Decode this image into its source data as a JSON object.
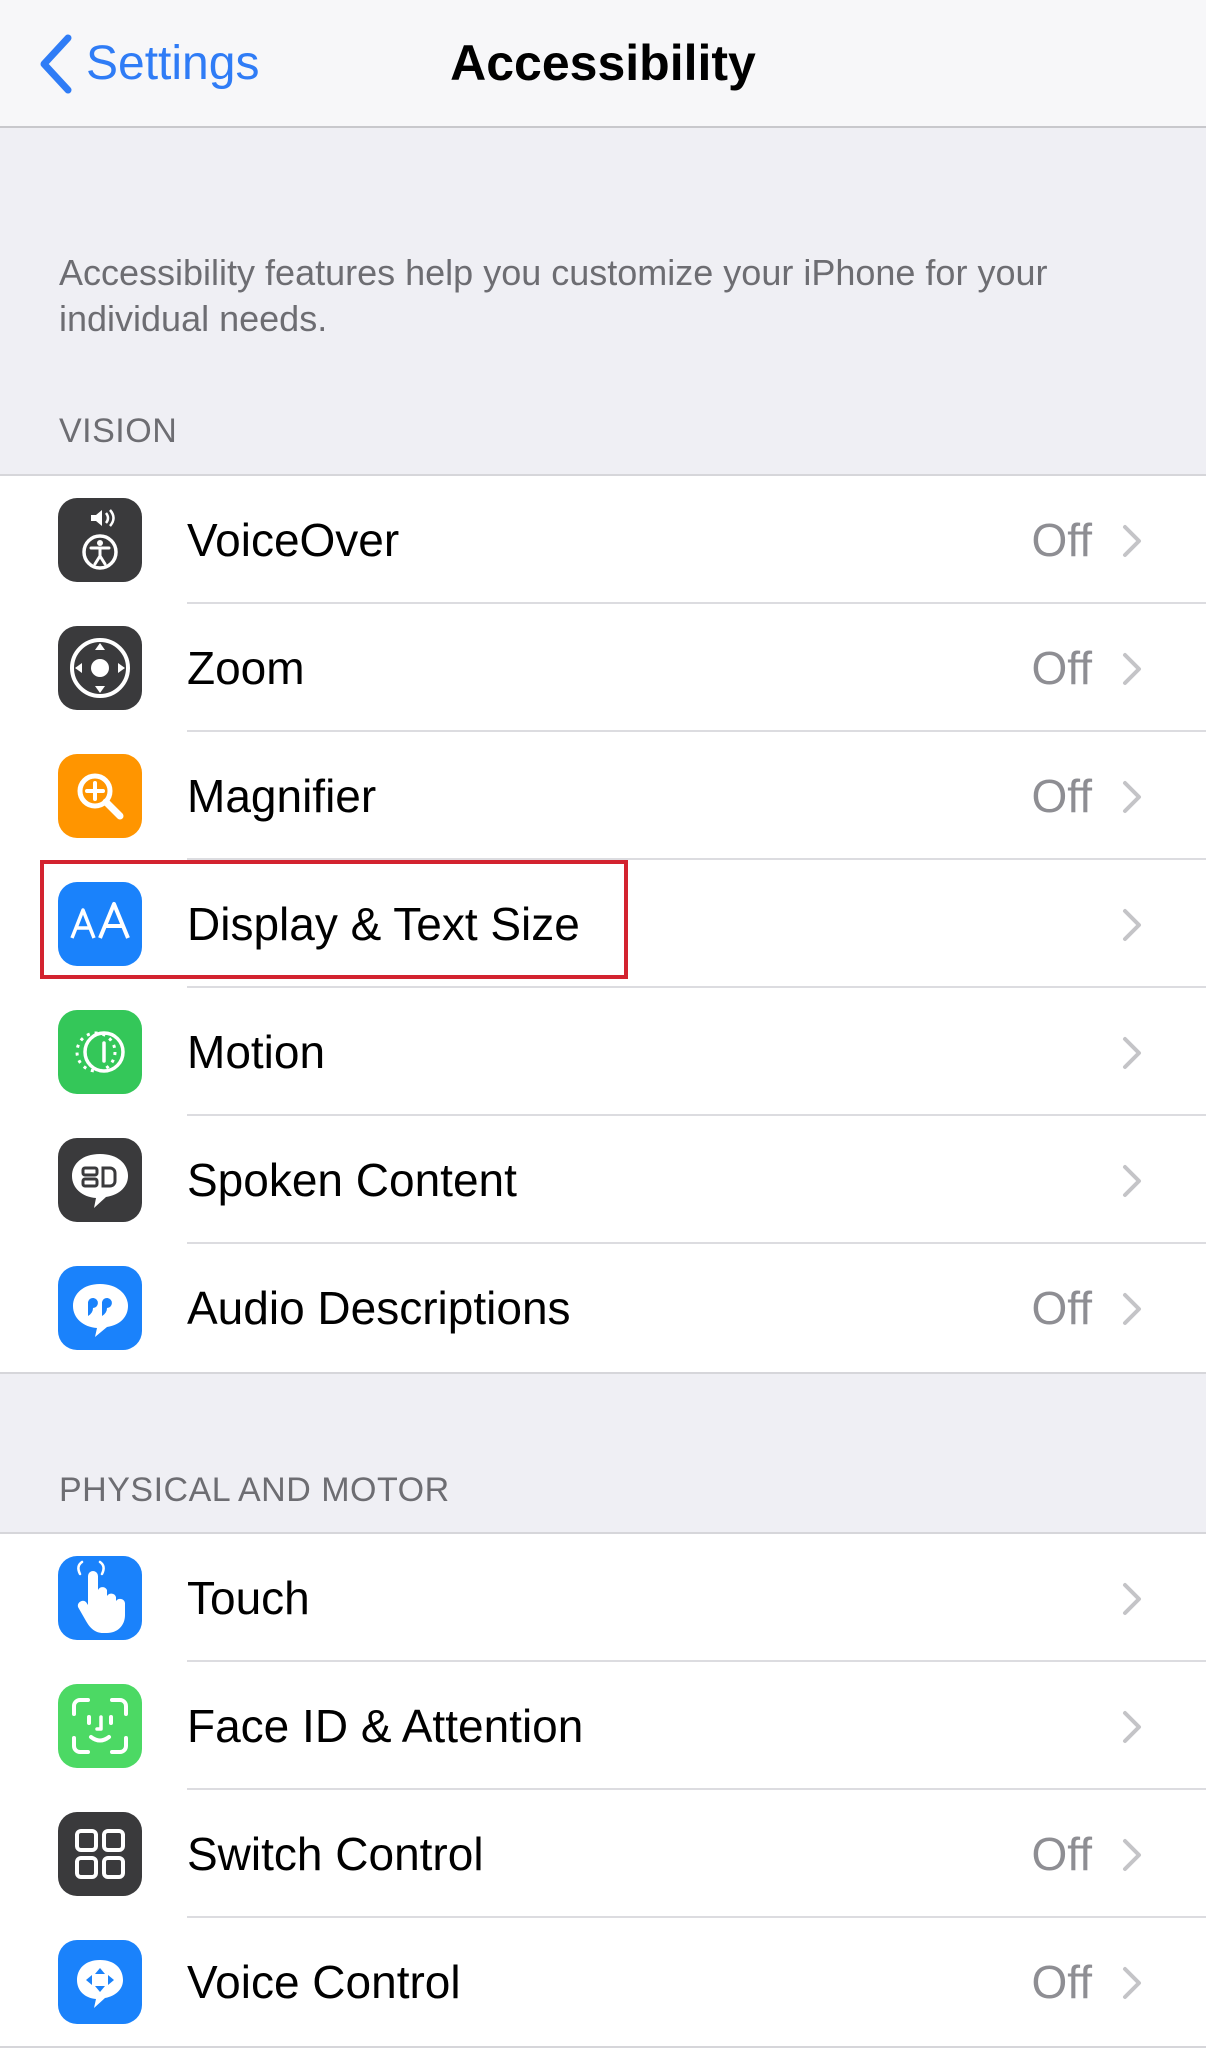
{
  "nav": {
    "back_label": "Settings",
    "title": "Accessibility"
  },
  "intro_text": "Accessibility features help you customize your iPhone for your individual needs.",
  "sections": {
    "vision": {
      "header": "VISION",
      "items": [
        {
          "label": "VoiceOver",
          "value": "Off",
          "icon": "voiceover-icon",
          "icon_bg": "#3a3a3c"
        },
        {
          "label": "Zoom",
          "value": "Off",
          "icon": "zoom-icon",
          "icon_bg": "#3a3a3c"
        },
        {
          "label": "Magnifier",
          "value": "Off",
          "icon": "magnifier-icon",
          "icon_bg": "#ff9500"
        },
        {
          "label": "Display & Text Size",
          "value": "",
          "icon": "display-text-size-icon",
          "icon_bg": "#1a82fb"
        },
        {
          "label": "Motion",
          "value": "",
          "icon": "motion-icon",
          "icon_bg": "#34c759"
        },
        {
          "label": "Spoken Content",
          "value": "",
          "icon": "spoken-content-icon",
          "icon_bg": "#3a3a3c"
        },
        {
          "label": "Audio Descriptions",
          "value": "Off",
          "icon": "audio-descriptions-icon",
          "icon_bg": "#1a82fb"
        }
      ]
    },
    "physical": {
      "header": "PHYSICAL AND MOTOR",
      "items": [
        {
          "label": "Touch",
          "value": "",
          "icon": "touch-icon",
          "icon_bg": "#1a82fb"
        },
        {
          "label": "Face ID & Attention",
          "value": "",
          "icon": "face-id-icon",
          "icon_bg": "#4cd964"
        },
        {
          "label": "Switch Control",
          "value": "Off",
          "icon": "switch-control-icon",
          "icon_bg": "#3a3a3c"
        },
        {
          "label": "Voice Control",
          "value": "Off",
          "icon": "voice-control-icon",
          "icon_bg": "#1a82fb"
        }
      ]
    }
  },
  "colors": {
    "accent": "#2f7cf6",
    "highlight": "#d3232f",
    "secondary_text": "#8e8e93",
    "background": "#efeff4"
  }
}
